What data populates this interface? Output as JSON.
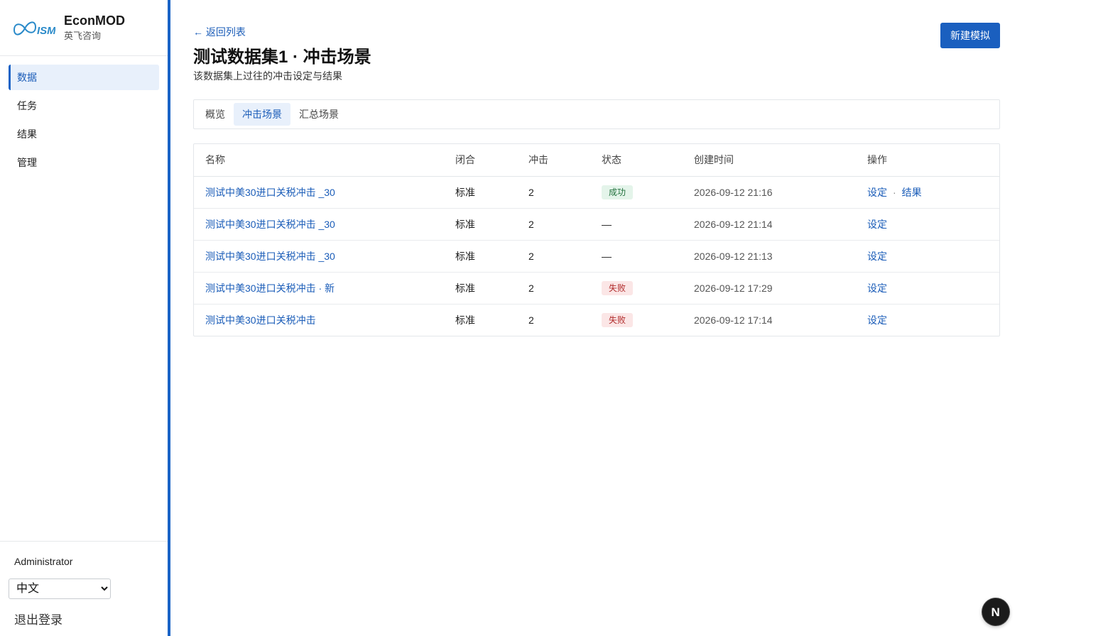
{
  "brand": {
    "name": "EconMOD",
    "subtitle": "英飞咨询",
    "logo_text": "ISM"
  },
  "sidebar": {
    "items": [
      {
        "label": "数据",
        "active": true
      },
      {
        "label": "任务",
        "active": false
      },
      {
        "label": "结果",
        "active": false
      },
      {
        "label": "管理",
        "active": false
      }
    ]
  },
  "footer": {
    "user": "Administrator",
    "language": "中文",
    "logout": "退出登录"
  },
  "header": {
    "back_link": "← 返回列表",
    "title": "测试数据集1 · 冲击场景",
    "subtitle": "该数据集上过往的冲击设定与结果",
    "primary_button": "新建模拟"
  },
  "tabs": [
    {
      "label": "概览",
      "active": false
    },
    {
      "label": "冲击场景",
      "active": true
    },
    {
      "label": "汇总场景",
      "active": false
    }
  ],
  "table": {
    "columns": [
      "名称",
      "闭合",
      "冲击",
      "状态",
      "创建时间",
      "操作"
    ],
    "rows": [
      {
        "name": "测试中美30进口关税冲击 _30",
        "closure": "标准",
        "shocks": "2",
        "status": "成功",
        "created": "2026-09-12 21:16",
        "action1": "设定",
        "action_sep": "·",
        "action2": "结果"
      },
      {
        "name": "测试中美30进口关税冲击 _30",
        "closure": "标准",
        "shocks": "2",
        "status": "—",
        "created": "2026-09-12 21:14",
        "action1": "设定"
      },
      {
        "name": "测试中美30进口关税冲击 _30",
        "closure": "标准",
        "shocks": "2",
        "status": "—",
        "created": "2026-09-12 21:13",
        "action1": "设定"
      },
      {
        "name": "测试中美30进口关税冲击 · 新",
        "closure": "标准",
        "shocks": "2",
        "status": "失败",
        "created": "2026-09-12 17:29",
        "action1": "设定"
      },
      {
        "name": "测试中美30进口关税冲击",
        "closure": "标准",
        "shocks": "2",
        "status": "失败",
        "created": "2026-09-12 17:14",
        "action1": "设定"
      }
    ]
  },
  "fab": {
    "label": "N"
  },
  "colors": {
    "accent": "#1a5fbf",
    "success_bg": "#e4f4ea",
    "success_text": "#24733f",
    "fail_bg": "#fbe6e6",
    "fail_text": "#b02a2a"
  },
  "icons": {
    "brand_logo": "infinity-logo-icon",
    "fab": "next-n-icon"
  }
}
